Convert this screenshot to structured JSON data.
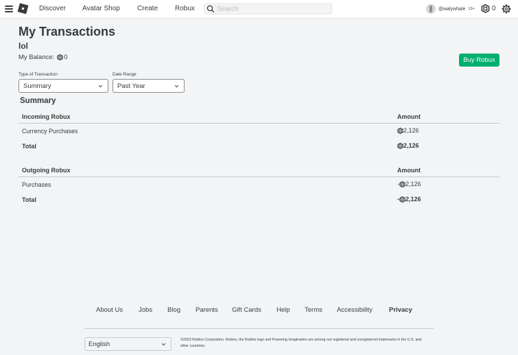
{
  "nav": {
    "links": [
      "Discover",
      "Avatar Shop",
      "Create",
      "Robux"
    ],
    "search_placeholder": "Search",
    "username": "@walywhale",
    "age_badge": "13+",
    "robux_count": "0"
  },
  "header": {
    "title": "My Transactions",
    "account_name": "lol",
    "balance_label": "My Balance:",
    "balance_value": "0",
    "buy_button": "Buy Robux"
  },
  "filters": {
    "type_label": "Type of Transaction",
    "type_value": "Summary",
    "range_label": "Date Range",
    "range_value": "Past Year"
  },
  "summary": {
    "title": "Summary",
    "incoming": {
      "header": "Incoming Robux",
      "amount_header": "Amount",
      "rows": [
        {
          "label": "Currency Purchases",
          "prefix": "",
          "value": "2,126"
        }
      ],
      "total": {
        "label": "Total",
        "prefix": "",
        "value": "2,126"
      }
    },
    "outgoing": {
      "header": "Outgoing Robux",
      "amount_header": "Amount",
      "rows": [
        {
          "label": "Purchases",
          "prefix": "-",
          "value": "2,126"
        }
      ],
      "total": {
        "label": "Total",
        "prefix": "-",
        "value": "2,126"
      }
    }
  },
  "footer": {
    "links": [
      "About Us",
      "Jobs",
      "Blog",
      "Parents",
      "Gift Cards",
      "Help",
      "Terms",
      "Accessibility",
      "Privacy"
    ],
    "language": "English",
    "copyright": "©2023 Roblox Corporation. Roblox, the Roblox logo and Powering Imagination are among our registered and unregistered trademarks in the U.S. and other countries."
  },
  "colors": {
    "accent_green": "#00b06f",
    "page_bg": "#f2f4f5",
    "text": "#393b3d"
  }
}
